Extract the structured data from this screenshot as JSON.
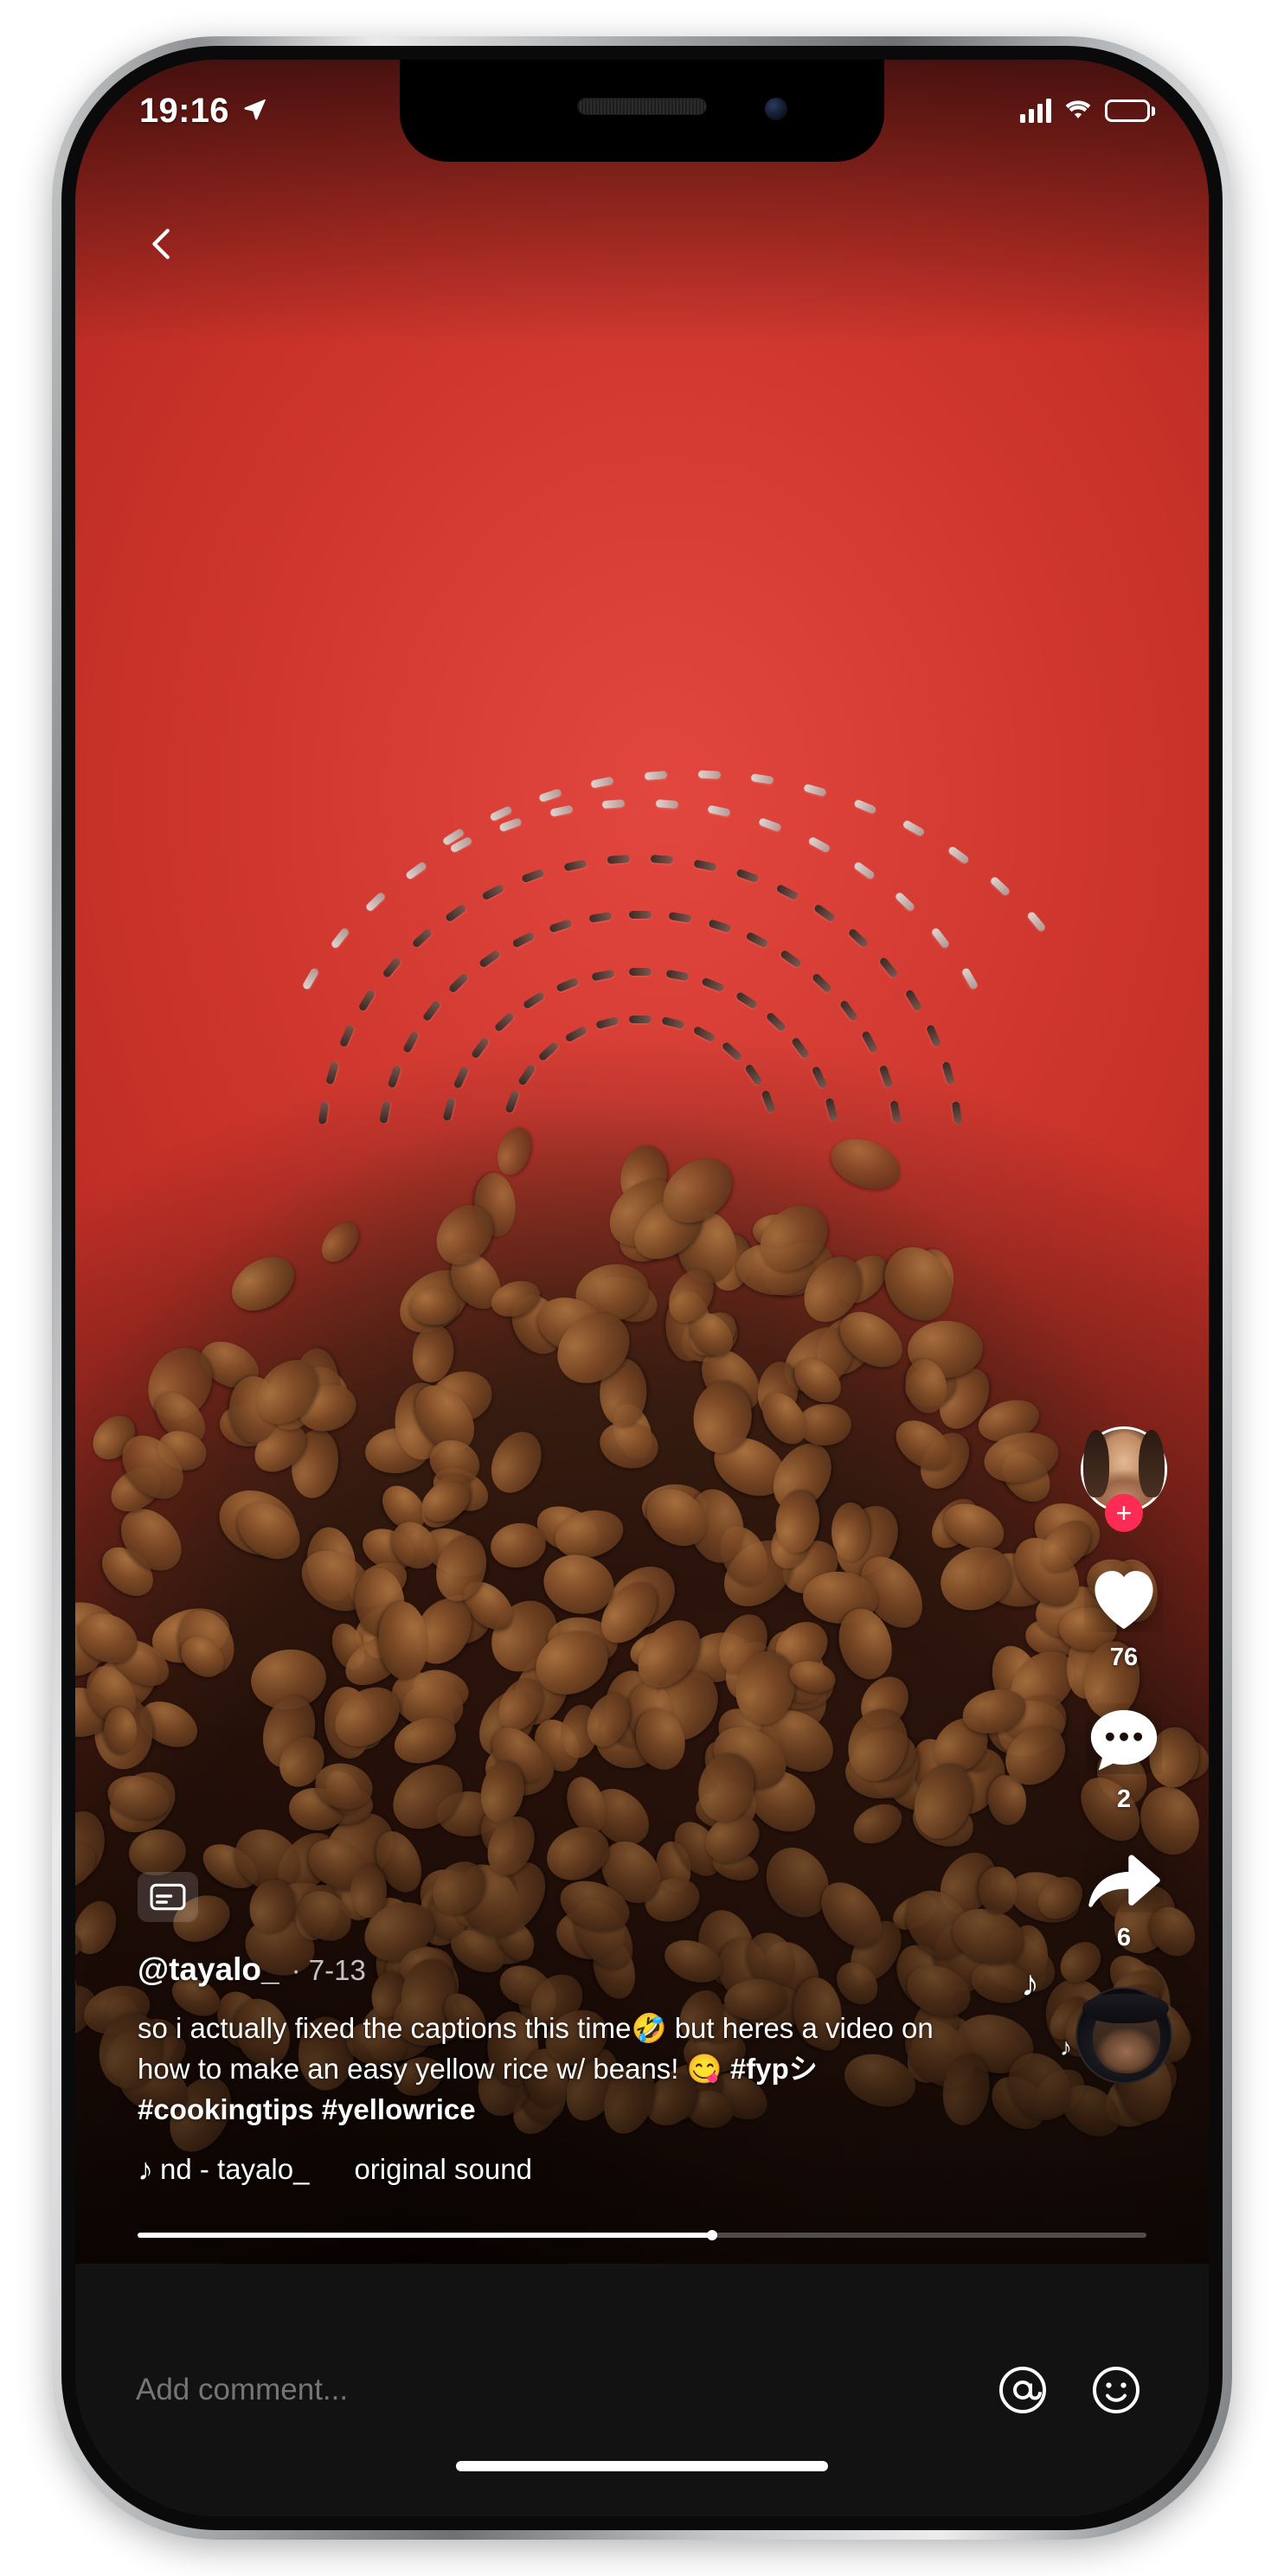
{
  "status_bar": {
    "time": "19:16",
    "location_icon": "location-arrow-icon",
    "signal_icon": "cellular-signal-icon",
    "wifi_icon": "wifi-icon",
    "battery_icon": "battery-full-icon"
  },
  "nav": {
    "back_icon": "chevron-left-icon"
  },
  "video": {
    "cc_icon": "closed-captions-icon",
    "author_handle": "@tayalo_",
    "post_date": "7-13",
    "caption": "so i actually fixed the captions this time🤣 but heres a video on how to make an easy yellow rice w/ beans! 😋 ",
    "caption_part_1": "so i actually fixed the captions this time🤣 but heres a video on how to make an easy yellow rice w/ beans! 😋 ",
    "hashtags": [
      "#fypシ",
      "#cookingtips",
      "#yellowrice"
    ],
    "music_note_icon": "music-note-icon",
    "music_title": "nd - tayalo_",
    "music_title_2": "original sound",
    "progress_percent": 57
  },
  "action_rail": {
    "avatar_label": "creator-avatar",
    "follow_label": "+",
    "like_icon": "heart-icon",
    "like_count": "76",
    "comment_icon": "comment-bubble-icon",
    "comment_count": "2",
    "share_icon": "share-arrow-icon",
    "share_count": "6",
    "sound_disc_label": "sound-disc"
  },
  "comment_bar": {
    "placeholder": "Add comment...",
    "mention_icon": "at-mention-icon",
    "emoji_icon": "emoji-smiley-icon"
  },
  "colors": {
    "accent_pink": "#fe2c55",
    "bar_background": "#121212",
    "text_primary": "#ffffff",
    "text_muted": "#8a8a8a"
  }
}
